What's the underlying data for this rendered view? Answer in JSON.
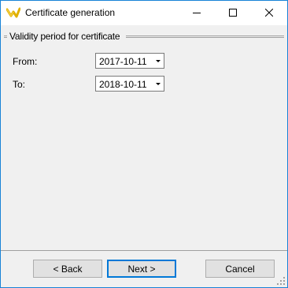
{
  "window": {
    "title": "Certificate generation",
    "icon": "yellow-arrow-app-icon",
    "controls": {
      "minimize": "minimize-icon",
      "maximize": "maximize-icon",
      "close": "close-icon"
    }
  },
  "group": {
    "title": "Validity period for certificate"
  },
  "fields": {
    "from": {
      "label": "From:",
      "value": "2017-10-11"
    },
    "to": {
      "label": "To:",
      "value": "2018-10-11"
    }
  },
  "buttons": {
    "back": "< Back",
    "next": "Next >",
    "cancel": "Cancel"
  },
  "colors": {
    "window_border": "#1883d7",
    "default_button_border": "#0078d7",
    "face": "#f0f0f0"
  }
}
